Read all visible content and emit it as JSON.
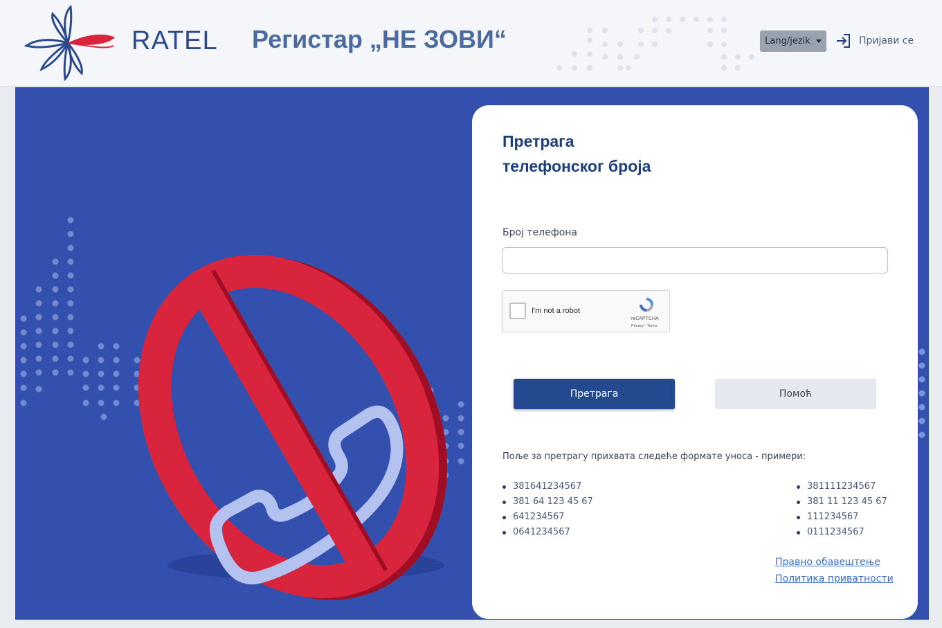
{
  "header": {
    "logo_text": "RATEL",
    "app_title": "Регистар „НЕ ЗОВИ“",
    "lang_button": "Lang/jezik",
    "login_label": "Пријави се"
  },
  "card": {
    "title_line1": "Претрага",
    "title_line2": "телефонског броја",
    "phone_label": "Број телефона",
    "phone_value": "",
    "recaptcha": {
      "label": "I'm not a robot",
      "brand": "reCAPTCHA",
      "terms": "Privacy - Terms"
    },
    "search_button": "Претрага",
    "help_button": "Помоћ",
    "formats_note": "Поље за претрагу прихвата следеће формате уноса - примери:",
    "examples_left": [
      "381641234567",
      "381 64 123 45 67",
      "641234567",
      "0641234567"
    ],
    "examples_right": [
      "381111234567",
      "381 11 123 45 67",
      "111234567",
      "0111234567"
    ],
    "link_legal": "Правно обавештење",
    "link_privacy": "Политика приватности"
  },
  "colors": {
    "banner_blue": "#3350ae",
    "primary_button": "#234a8f",
    "forbidden_red": "#d8243c",
    "link": "#3d6fc9"
  },
  "icons": [
    "ratel-logo",
    "chevron-down-icon",
    "login-icon",
    "phone-icon",
    "forbidden-sign-icon",
    "recaptcha-icon"
  ]
}
